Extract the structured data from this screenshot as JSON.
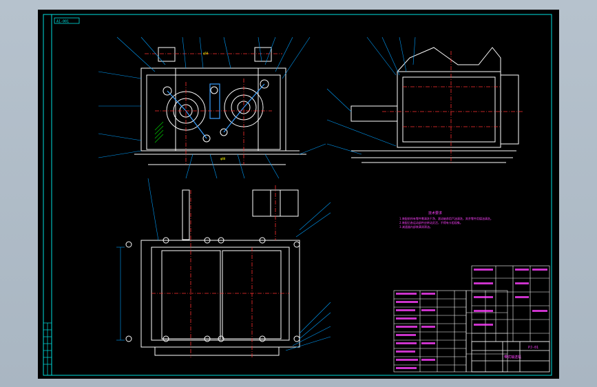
{
  "viewport": {
    "title_block_tag": "A1-001",
    "notes": {
      "heading": "技术要求",
      "lines": [
        "1.装配前所有零件需清洗干净，滚动轴承用汽油清洗，其余零件用煤油清洗。",
        "2.装配后各运动部件应转动灵活，不得有卡阻现象。",
        "3.减速器内部装满润滑油。"
      ]
    },
    "title_block": {
      "drawing_name": "带式输送机",
      "drawing_no": "PJ-01"
    },
    "colors": {
      "background": "#000000",
      "frame": "#00e0e0",
      "outline": "#ffffff",
      "centerline": "#ff3030",
      "leader": "#00a0ff",
      "table_text": "#ff40ff",
      "annotation": "#ffff00",
      "hatch": "#00c000"
    }
  }
}
